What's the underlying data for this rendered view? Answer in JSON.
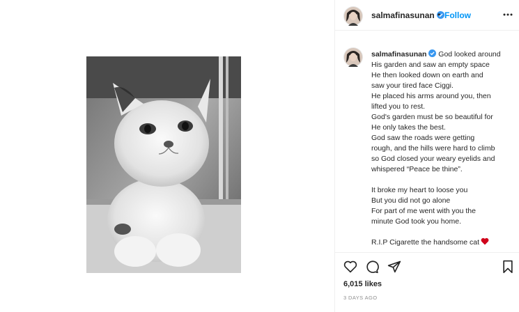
{
  "post": {
    "username": "salmafinasunan",
    "follow_label": "Follow",
    "separator": "•",
    "caption_lines": [
      "God looked around",
      "His garden and saw an empty space",
      "He then looked down on earth and",
      "saw your tired face Ciggi.",
      "He placed his arms around you, then",
      "lifted you to rest.",
      "God's garden must be so beautiful for",
      "He only takes the best.",
      "God saw the roads were getting",
      "rough, and the hills were hard to climb",
      "so God closed your weary eyelids and",
      "whispered “Peace be thine”.",
      "It broke my heart to loose you",
      "But you did not go alone",
      "For part of me went with you the",
      "minute God took you home.",
      "R.I.P Cigarette the handsome cat"
    ],
    "likes": "6,015 likes",
    "time_ago": "3 DAYS AGO"
  },
  "icons": {
    "verified": "verified-badge-icon",
    "more": "more-options-icon",
    "like": "heart-outline-icon",
    "comment": "comment-bubble-icon",
    "share": "paper-plane-icon",
    "save": "bookmark-outline-icon",
    "emoji": "red-heart-emoji"
  },
  "colors": {
    "link_blue": "#0095f6",
    "verified_blue": "#3897f0",
    "text": "#262626",
    "muted": "#8e8e8e",
    "divider": "#efefef",
    "heart_red": "#d0021b"
  }
}
